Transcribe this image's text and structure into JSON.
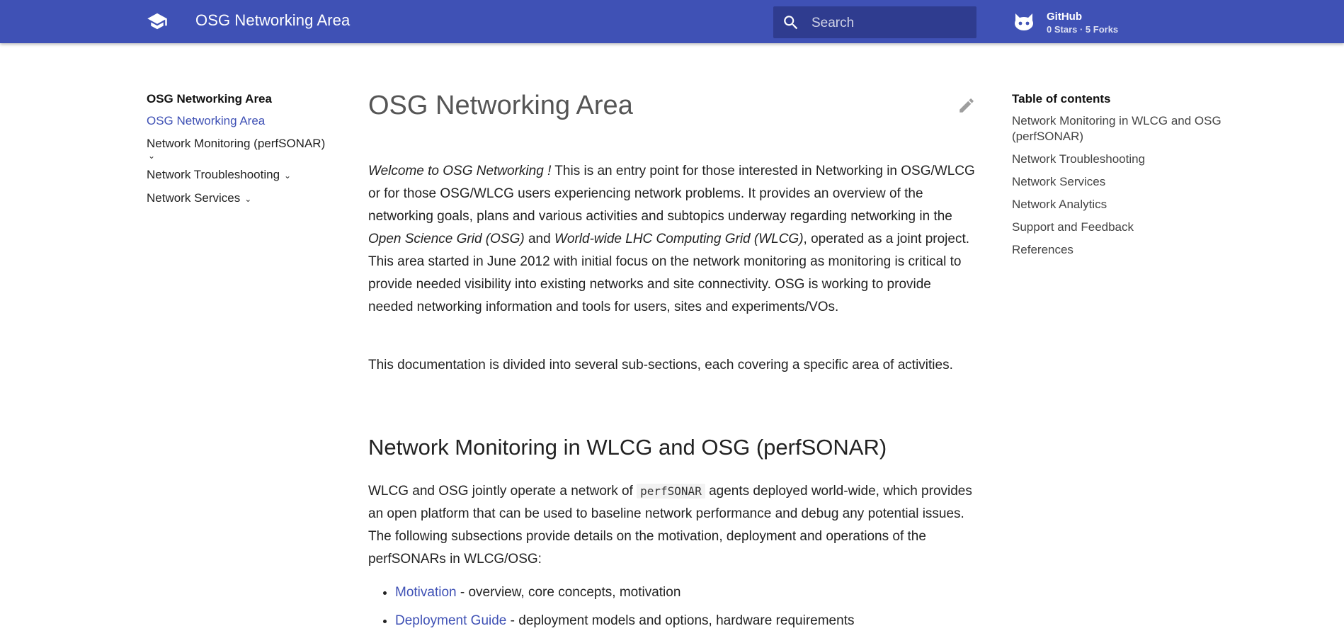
{
  "header": {
    "site_title": "OSG Networking Area",
    "search_placeholder": "Search",
    "repo_name": "GitHub",
    "repo_facts": "0 Stars · 5 Forks"
  },
  "nav": {
    "title": "OSG Networking Area",
    "items": [
      {
        "label": "OSG Networking Area",
        "active": true
      },
      {
        "label": "Network Monitoring (perfSONAR)",
        "expandable": true
      },
      {
        "label": "Network Troubleshooting",
        "expandable": true
      },
      {
        "label": "Network Services",
        "expandable": true
      }
    ]
  },
  "main": {
    "title": "OSG Networking Area",
    "p1": {
      "welcome": "Welcome to OSG Networking !",
      "text1": " This is an entry point for those interested in Networking in OSG/WLCG or for those OSG/WLCG users experiencing network problems. It provides an overview of the networking goals, plans and various activities and subtopics underway regarding networking in the ",
      "osg": "Open Science Grid (OSG)",
      "and": " and ",
      "wlcg": "World-wide LHC Computing Grid (WLCG)",
      "text2": ", operated as a joint project. This area started in June 2012 with initial focus on the network monitoring as monitoring is critical to provide needed visibility into existing networks and site connectivity. OSG is working to provide needed networking information and tools for users, sites and experiments/VOs."
    },
    "p2": "This documentation is divided into several sub-sections, each covering a specific area of activities.",
    "section1": {
      "heading": "Network Monitoring in WLCG and OSG (perfSONAR)",
      "text_before": "WLCG and OSG jointly operate a network of ",
      "code": "perfSONAR",
      "text_after": " agents deployed world-wide, which provides an open platform that can be used to baseline network performance and debug any potential issues. The following subsections provide details on the motivation, deployment and operations of the perfSONARs in WLCG/OSG:",
      "list": [
        {
          "link": "Motivation",
          "desc": " - overview, core concepts, motivation"
        },
        {
          "link": "Deployment Guide",
          "desc": " - deployment models and options, hardware requirements"
        }
      ]
    }
  },
  "toc": {
    "title": "Table of contents",
    "items": [
      "Network Monitoring in WLCG and OSG (perfSONAR)",
      "Network Troubleshooting",
      "Network Services",
      "Network Analytics",
      "Support and Feedback",
      "References"
    ]
  },
  "colors": {
    "primary": "#3f51b5",
    "search_bg": "#2f3c8f",
    "link": "#3f51b5"
  },
  "icons": {
    "logo": "school-icon",
    "search": "search-icon",
    "repo": "github-icon",
    "edit": "pencil-icon",
    "expand": "chevron-down-icon"
  }
}
